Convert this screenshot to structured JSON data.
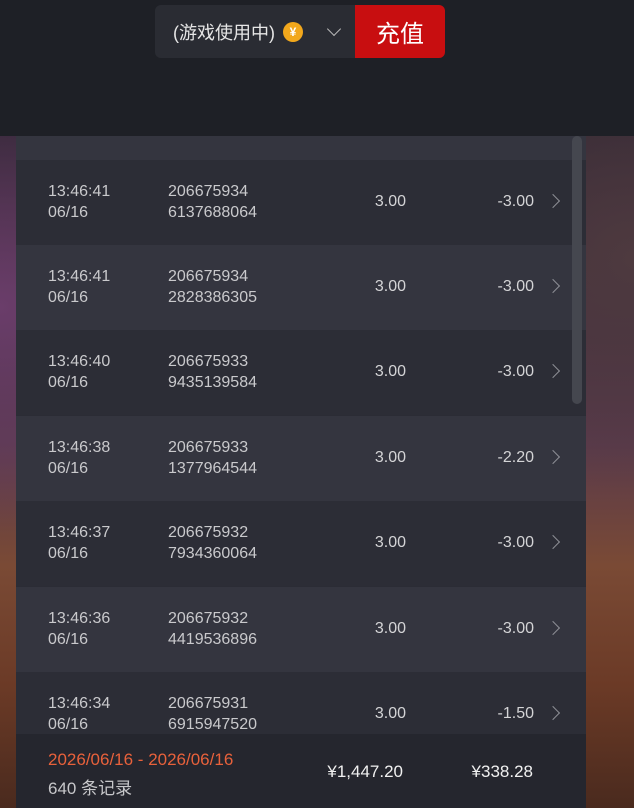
{
  "header": {
    "wallet_label": "(游戏使用中)",
    "coin_symbol": "¥",
    "recharge_label": "充值"
  },
  "records": [
    {
      "time": "13:46:41",
      "date": "06/16",
      "order_line1": "206675934",
      "order_line2": "6137688064",
      "amount": "3.00",
      "balance": "-3.00"
    },
    {
      "time": "13:46:41",
      "date": "06/16",
      "order_line1": "206675934",
      "order_line2": "2828386305",
      "amount": "3.00",
      "balance": "-3.00"
    },
    {
      "time": "13:46:40",
      "date": "06/16",
      "order_line1": "206675933",
      "order_line2": "9435139584",
      "amount": "3.00",
      "balance": "-3.00"
    },
    {
      "time": "13:46:38",
      "date": "06/16",
      "order_line1": "206675933",
      "order_line2": "1377964544",
      "amount": "3.00",
      "balance": "-2.20"
    },
    {
      "time": "13:46:37",
      "date": "06/16",
      "order_line1": "206675932",
      "order_line2": "7934360064",
      "amount": "3.00",
      "balance": "-3.00"
    },
    {
      "time": "13:46:36",
      "date": "06/16",
      "order_line1": "206675932",
      "order_line2": "4419536896",
      "amount": "3.00",
      "balance": "-3.00"
    },
    {
      "time": "13:46:34",
      "date": "06/16",
      "order_line1": "206675931",
      "order_line2": "6915947520",
      "amount": "3.00",
      "balance": "-1.50"
    }
  ],
  "footer": {
    "date_range": "2026/06/16 - 2026/06/16",
    "record_count": "640 条记录",
    "total_amount": "¥1,447.20",
    "total_result": "¥338.28"
  },
  "colors": {
    "recharge_button": "#c80e10",
    "date_range_text": "#e8613b",
    "coin": "#f2a81c"
  }
}
